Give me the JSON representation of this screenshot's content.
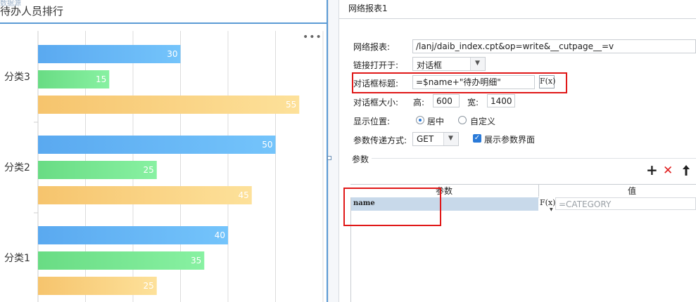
{
  "left": {
    "tiny_label": "数据源",
    "title": "待办人员排行",
    "more": "•••"
  },
  "chart_data": {
    "type": "bar",
    "orientation": "horizontal",
    "categories": [
      "分类3",
      "分类2",
      "分类1"
    ],
    "series": [
      {
        "values": [
          30,
          50,
          40
        ],
        "color": "#5aa9f0"
      },
      {
        "values": [
          15,
          25,
          35
        ],
        "color": "#69dc84"
      },
      {
        "values": [
          55,
          45,
          25
        ],
        "color": "#f6c46d"
      }
    ],
    "xlim": [
      0,
      60
    ],
    "grid": true,
    "data_labels": true
  },
  "right": {
    "tab_title": "网络报表1",
    "url_label": "网络报表:",
    "url_value": "/lanj/daib_index.cpt&op=write&__cutpage__=v",
    "open_label": "链接打开于:",
    "open_value": "对话框",
    "dialog_title_label": "对话框标题:",
    "dialog_title_value": "=$name+\"待办明细\"",
    "fx": "F(x)",
    "size_label": "对话框大小:",
    "height_label": "高:",
    "height_value": "600",
    "width_label": "宽:",
    "width_value": "1400",
    "position_label": "显示位置:",
    "position_center": "居中",
    "position_custom": "自定义",
    "method_label": "参数传递方式:",
    "method_value": "GET",
    "show_params": "展示参数界面",
    "params_section": "参数",
    "add_icon": "+",
    "delete_icon": "✕",
    "up_icon": "🡑",
    "col_param": "参数",
    "col_value": "值",
    "row_name": "name",
    "row_value": "=CATEGORY"
  },
  "colors": {
    "accent": "#5b9bd5",
    "highlight": "#e01818",
    "check": "#2a7ad8"
  }
}
